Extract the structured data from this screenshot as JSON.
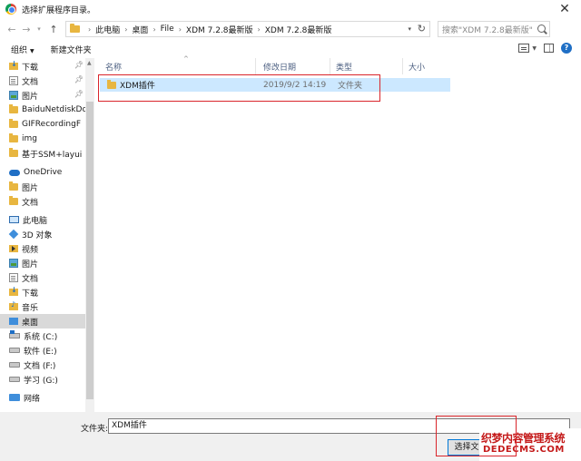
{
  "window": {
    "title": "选择扩展程序目录。"
  },
  "address": {
    "crumbs": [
      "此电脑",
      "桌面",
      "File",
      "XDM 7.2.8最新版",
      "XDM 7.2.8最新版"
    ]
  },
  "search": {
    "placeholder": "搜索\"XDM 7.2.8最新版\""
  },
  "toolbar": {
    "organize": "组织",
    "new_folder": "新建文件夹"
  },
  "nav": {
    "quick": [
      {
        "label": "下载",
        "icon": "download-icon",
        "pinned": true
      },
      {
        "label": "文档",
        "icon": "document-icon",
        "pinned": true
      },
      {
        "label": "图片",
        "icon": "picture-icon",
        "pinned": true
      },
      {
        "label": "BaiduNetdiskDo",
        "icon": "folder-icon",
        "pinned": false
      },
      {
        "label": "GIFRecordingF",
        "icon": "folder-icon",
        "pinned": false
      },
      {
        "label": "img",
        "icon": "folder-icon",
        "pinned": false
      },
      {
        "label": "基于SSM+layui",
        "icon": "folder-icon",
        "pinned": false
      }
    ],
    "onedrive": {
      "label": "OneDrive",
      "items": [
        "图片",
        "文档"
      ]
    },
    "thispc": {
      "label": "此电脑",
      "items": [
        {
          "label": "3D 对象",
          "icon": "cube-icon"
        },
        {
          "label": "视频",
          "icon": "video-icon"
        },
        {
          "label": "图片",
          "icon": "picture-icon"
        },
        {
          "label": "文档",
          "icon": "document-icon"
        },
        {
          "label": "下载",
          "icon": "download-icon"
        },
        {
          "label": "音乐",
          "icon": "music-icon"
        },
        {
          "label": "桌面",
          "icon": "desktop-icon"
        },
        {
          "label": "系统 (C:)",
          "icon": "drive-c-icon"
        },
        {
          "label": "软件 (E:)",
          "icon": "drive-icon"
        },
        {
          "label": "文档 (F:)",
          "icon": "drive-icon"
        },
        {
          "label": "学习 (G:)",
          "icon": "drive-icon"
        }
      ]
    },
    "network": {
      "label": "网络"
    }
  },
  "columns": {
    "name": "名称",
    "date": "修改日期",
    "type": "类型",
    "size": "大小"
  },
  "files": [
    {
      "name": "XDM插件",
      "date": "2019/9/2 14:19",
      "type": "文件夹"
    }
  ],
  "footer": {
    "folder_label": "文件夹:",
    "folder_value": "XDM插件",
    "select_button": "选择文件夹"
  },
  "watermark": {
    "line1": "织梦内容管理系统",
    "line2": "DEDECMS.COM"
  },
  "colors": {
    "selection": "#cce8ff",
    "highlight": "#d9252b",
    "accent": "#0078d7"
  }
}
